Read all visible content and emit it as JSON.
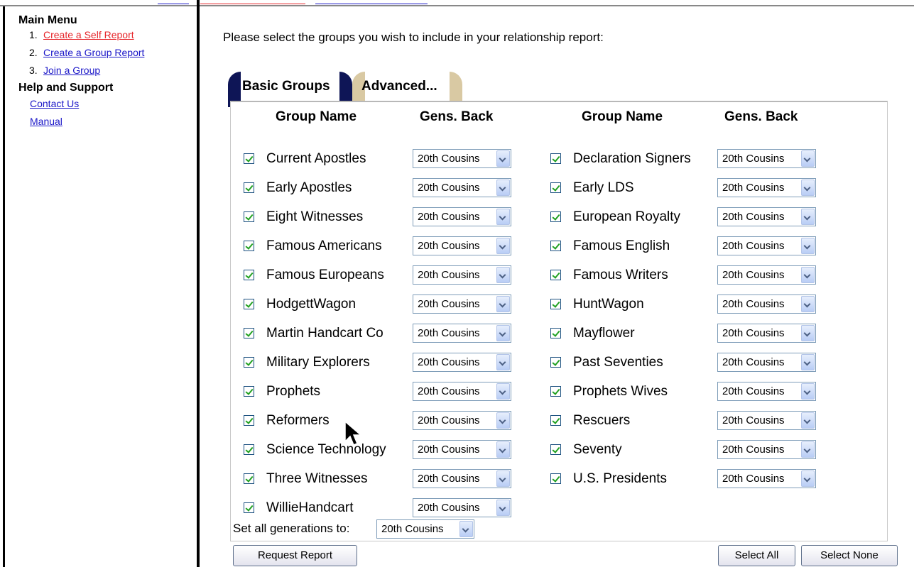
{
  "sidebar": {
    "main_menu_heading": "Main Menu",
    "menu_items": [
      {
        "num": "1.",
        "label": "Create a Self Report",
        "active": true
      },
      {
        "num": "2.",
        "label": "Create a Group Report",
        "active": false
      },
      {
        "num": "3.",
        "label": "Join a Group",
        "active": false
      }
    ],
    "help_heading": "Help and Support",
    "help_items": [
      {
        "label": "Contact Us"
      },
      {
        "label": "Manual"
      }
    ]
  },
  "main": {
    "intro": "Please select the groups you wish to include in your relationship report:",
    "tabs": [
      {
        "label": "Basic Groups",
        "active": true
      },
      {
        "label": "Advanced...",
        "active": false
      }
    ],
    "headers": {
      "group_name": "Group Name",
      "gens_back": "Gens. Back"
    },
    "left_groups": [
      {
        "name": "Current Apostles",
        "checked": true,
        "gens": "20th Cousins"
      },
      {
        "name": "Early Apostles",
        "checked": true,
        "gens": "20th Cousins"
      },
      {
        "name": "Eight Witnesses",
        "checked": true,
        "gens": "20th Cousins"
      },
      {
        "name": "Famous Americans",
        "checked": true,
        "gens": "20th Cousins"
      },
      {
        "name": "Famous Europeans",
        "checked": true,
        "gens": "20th Cousins"
      },
      {
        "name": "HodgettWagon",
        "checked": true,
        "gens": "20th Cousins"
      },
      {
        "name": "Martin Handcart Co",
        "checked": true,
        "gens": "20th Cousins"
      },
      {
        "name": "Military Explorers",
        "checked": true,
        "gens": "20th Cousins"
      },
      {
        "name": "Prophets",
        "checked": true,
        "gens": "20th Cousins"
      },
      {
        "name": "Reformers",
        "checked": true,
        "gens": "20th Cousins"
      },
      {
        "name": "Science Technology",
        "checked": true,
        "gens": "20th Cousins"
      },
      {
        "name": "Three Witnesses",
        "checked": true,
        "gens": "20th Cousins"
      },
      {
        "name": "WillieHandcart",
        "checked": true,
        "gens": "20th Cousins"
      }
    ],
    "right_groups": [
      {
        "name": "Declaration Signers",
        "checked": true,
        "gens": "20th Cousins"
      },
      {
        "name": "Early LDS",
        "checked": true,
        "gens": "20th Cousins"
      },
      {
        "name": "European Royalty",
        "checked": true,
        "gens": "20th Cousins"
      },
      {
        "name": "Famous English",
        "checked": true,
        "gens": "20th Cousins"
      },
      {
        "name": "Famous Writers",
        "checked": true,
        "gens": "20th Cousins"
      },
      {
        "name": "HuntWagon",
        "checked": true,
        "gens": "20th Cousins"
      },
      {
        "name": "Mayflower",
        "checked": true,
        "gens": "20th Cousins"
      },
      {
        "name": "Past Seventies",
        "checked": true,
        "gens": "20th Cousins"
      },
      {
        "name": "Prophets Wives",
        "checked": true,
        "gens": "20th Cousins"
      },
      {
        "name": "Rescuers",
        "checked": true,
        "gens": "20th Cousins"
      },
      {
        "name": "Seventy",
        "checked": true,
        "gens": "20th Cousins"
      },
      {
        "name": "U.S. Presidents",
        "checked": true,
        "gens": "20th Cousins"
      }
    ],
    "set_all_label": "Set all generations to:",
    "set_all_value": "20th Cousins",
    "buttons": {
      "request_report": "Request Report",
      "select_all": "Select All",
      "select_none": "Select None"
    }
  },
  "colors": {
    "link": "#1b17c8",
    "active_link": "#e6252a",
    "tab_active": "#0e1556",
    "tab_inactive": "#d9c9a3"
  }
}
